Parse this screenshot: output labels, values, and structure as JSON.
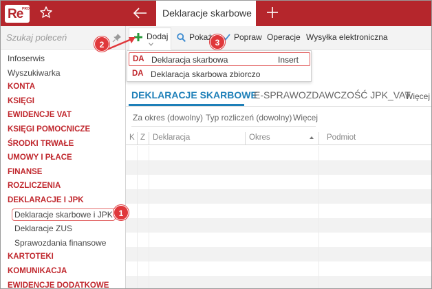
{
  "app": {
    "logo_text": "Re",
    "logo_sub": "PRO",
    "brand_color": "#b5262c"
  },
  "header": {
    "active_tab": "Deklaracje skarbowe"
  },
  "sidebar": {
    "search_placeholder": "Szukaj poleceń",
    "items": [
      {
        "label": "Infoserwis",
        "kind": "plain"
      },
      {
        "label": "Wyszukiwarka",
        "kind": "plain"
      },
      {
        "label": "KONTA",
        "kind": "category"
      },
      {
        "label": "KSIĘGI",
        "kind": "category"
      },
      {
        "label": "EWIDENCJE VAT",
        "kind": "category"
      },
      {
        "label": "KSIĘGI POMOCNICZE",
        "kind": "category"
      },
      {
        "label": "ŚRODKI TRWAŁE",
        "kind": "category"
      },
      {
        "label": "UMOWY I PŁACE",
        "kind": "category"
      },
      {
        "label": "FINANSE",
        "kind": "category"
      },
      {
        "label": "ROZLICZENIA",
        "kind": "category"
      },
      {
        "label": "DEKLARACJE I JPK",
        "kind": "category"
      },
      {
        "label": "Deklaracje skarbowe i JPK",
        "kind": "sub",
        "selected": true
      },
      {
        "label": "Deklaracje ZUS",
        "kind": "sub"
      },
      {
        "label": "Sprawozdania finansowe",
        "kind": "sub"
      },
      {
        "label": "KARTOTEKI",
        "kind": "category"
      },
      {
        "label": "KOMUNIKACJA",
        "kind": "category"
      },
      {
        "label": "EWIDENCJE DODATKOWE",
        "kind": "category"
      }
    ]
  },
  "toolbar": {
    "add": "Dodaj",
    "show": "Pokaż",
    "edit": "Popraw",
    "operations": "Operacje",
    "e_send": "Wysyłka elektroniczna"
  },
  "dropdown": {
    "items": [
      {
        "code": "DA",
        "label": "Deklaracja skarbowa",
        "shortcut": "Insert"
      },
      {
        "code": "DA",
        "label": "Deklaracja skarbowa zbiorczo",
        "shortcut": ""
      }
    ]
  },
  "content_tabs": {
    "active": "DEKLARACJE SKARBOWE",
    "other": "E-SPRAWOZDAWCZOŚĆ JPK_VAT",
    "more": "Więcej"
  },
  "filters": {
    "period": "Za okres (dowolny)",
    "type": "Typ rozliczeń (dowolny)",
    "more": "Więcej"
  },
  "grid": {
    "columns": [
      "K",
      "Z",
      "Deklaracja",
      "Okres",
      "Podmiot"
    ]
  },
  "callouts": [
    "1",
    "2",
    "3"
  ]
}
